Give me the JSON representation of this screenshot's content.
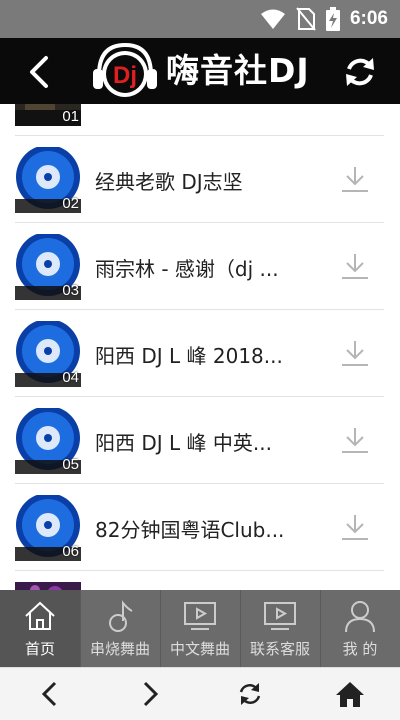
{
  "status_bar": {
    "time": "6:06",
    "icons": [
      "wifi-icon",
      "no-sim-icon",
      "battery-charging-icon"
    ]
  },
  "header": {
    "logo_text": "Dj",
    "title": "嗨音社DJ",
    "back_icon": "chevron-left-icon",
    "refresh_icon": "refresh-icon"
  },
  "list": {
    "items": [
      {
        "number": "01",
        "title": ""
      },
      {
        "number": "02",
        "title": "经典老歌 DJ志坚"
      },
      {
        "number": "03",
        "title": "雨宗林 - 感谢（dj ..."
      },
      {
        "number": "04",
        "title": "阳西 DJ L 峰 2018..."
      },
      {
        "number": "05",
        "title": "阳西 DJ L 峰 中英..."
      },
      {
        "number": "06",
        "title": "82分钟国粤语Club..."
      },
      {
        "number": "",
        "title": ""
      }
    ]
  },
  "tabbar": {
    "tabs": [
      {
        "label": "首页",
        "icon": "home-icon",
        "active": true
      },
      {
        "label": "串烧舞曲",
        "icon": "music-note-icon",
        "active": false
      },
      {
        "label": "中文舞曲",
        "icon": "tv-play-icon",
        "active": false
      },
      {
        "label": "联系客服",
        "icon": "tv-play-icon",
        "active": false
      },
      {
        "label": "我 的",
        "icon": "user-icon",
        "active": false
      }
    ]
  },
  "navbar": {
    "buttons": [
      "back-arrow-icon",
      "forward-arrow-icon",
      "reload-icon",
      "home-icon"
    ]
  }
}
